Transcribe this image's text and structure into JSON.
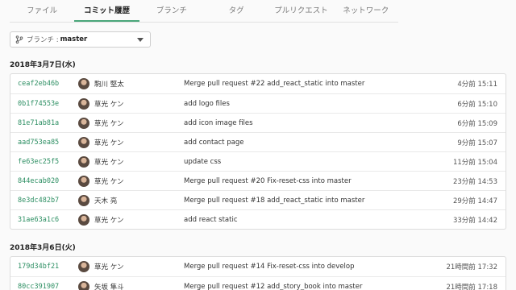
{
  "tabs": [
    {
      "label": "ファイル"
    },
    {
      "label": "コミット履歴"
    },
    {
      "label": "ブランチ"
    },
    {
      "label": "タグ"
    },
    {
      "label": "プルリクエスト"
    },
    {
      "label": "ネットワーク"
    }
  ],
  "branch": {
    "label": "ブランチ :",
    "value": "master"
  },
  "groups": [
    {
      "date": "2018年3月7日(水)",
      "commits": [
        {
          "hash": "ceaf2eb46b",
          "author": "駒川 堅太",
          "message": "Merge pull request #22 add_react_static into master",
          "time": "4分前 15:11"
        },
        {
          "hash": "0b1f74553e",
          "author": "草光 ケン",
          "message": "add logo files",
          "time": "6分前 15:10"
        },
        {
          "hash": "81e71ab81a",
          "author": "草光 ケン",
          "message": "add icon image files",
          "time": "6分前 15:09"
        },
        {
          "hash": "aad753ea85",
          "author": "草光 ケン",
          "message": "add contact page",
          "time": "9分前 15:07"
        },
        {
          "hash": "fe63ec25f5",
          "author": "草光 ケン",
          "message": "update css",
          "time": "11分前 15:04"
        },
        {
          "hash": "844ecab020",
          "author": "草光 ケン",
          "message": "Merge pull request #20 Fix-reset-css into master",
          "time": "23分前 14:53"
        },
        {
          "hash": "8e3dc482b7",
          "author": "天木 亮",
          "message": "Merge pull request #18 add_react_static into master",
          "time": "29分前 14:47"
        },
        {
          "hash": "31ae63a1c6",
          "author": "草光 ケン",
          "message": "add react static",
          "time": "33分前 14:42"
        }
      ]
    },
    {
      "date": "2018年3月6日(火)",
      "commits": [
        {
          "hash": "179d34bf21",
          "author": "草光 ケン",
          "message": "Merge pull request #14 Fix-reset-css into develop",
          "time": "21時間前 17:32"
        },
        {
          "hash": "80cc391907",
          "author": "矢坂 隼斗",
          "message": "Merge pull request #12 add_story_book into master",
          "time": "21時間前 17:18"
        }
      ]
    }
  ]
}
